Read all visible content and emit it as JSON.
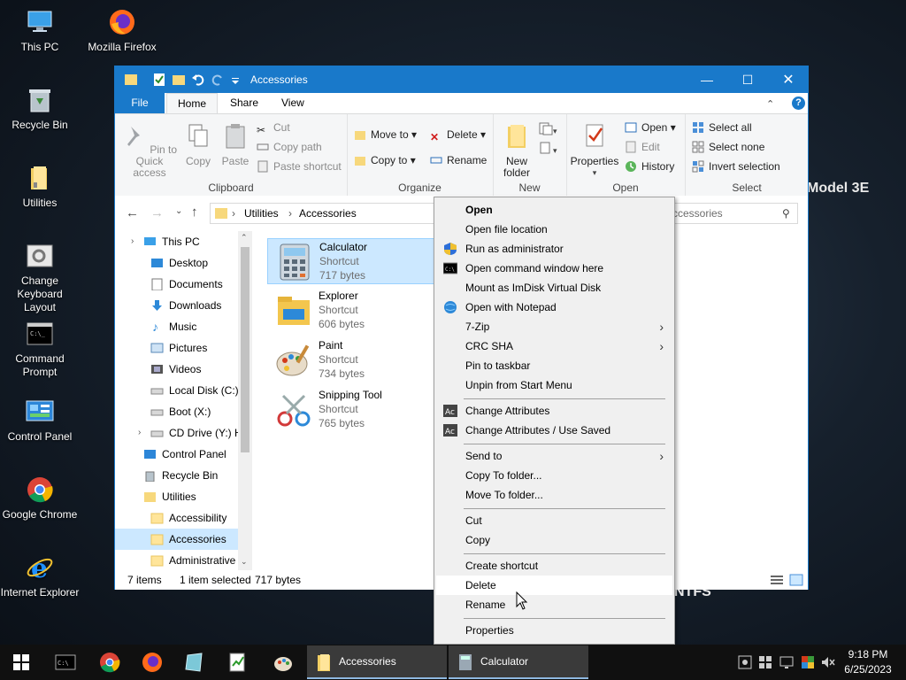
{
  "desktop": {
    "icons": [
      {
        "label": "This PC"
      },
      {
        "label": "Mozilla Firefox"
      },
      {
        "label": "Recycle Bin"
      },
      {
        "label": "Utilities"
      },
      {
        "label": "Change Keyboard Layout"
      },
      {
        "label": "Command Prompt"
      },
      {
        "label": "Control Panel"
      },
      {
        "label": "Google Chrome"
      },
      {
        "label": "Internet Explorer"
      }
    ],
    "bg_text_1": "Model 3E",
    "bg_text_2": "NTFS"
  },
  "window": {
    "title": "Accessories",
    "tabs": {
      "file": "File",
      "home": "Home",
      "share": "Share",
      "view": "View"
    },
    "ribbon": {
      "clipboard": {
        "label": "Clipboard",
        "pin": "Pin to Quick access",
        "copy": "Copy",
        "paste": "Paste",
        "cut": "Cut",
        "copy_path": "Copy path",
        "paste_shortcut": "Paste shortcut"
      },
      "organize": {
        "label": "Organize",
        "move_to": "Move to",
        "copy_to": "Copy to",
        "delete": "Delete",
        "rename": "Rename"
      },
      "new": {
        "label": "New",
        "new_folder": "New folder"
      },
      "open": {
        "label": "Open",
        "properties": "Properties",
        "open": "Open",
        "edit": "Edit",
        "history": "History"
      },
      "select": {
        "label": "Select",
        "select_all": "Select all",
        "select_none": "Select none",
        "invert": "Invert selection"
      }
    },
    "address": {
      "part1": "Utilities",
      "part2": "Accessories"
    },
    "search_placeholder": "ccessories",
    "nav": [
      {
        "label": "This PC"
      },
      {
        "label": "Desktop"
      },
      {
        "label": "Documents"
      },
      {
        "label": "Downloads"
      },
      {
        "label": "Music"
      },
      {
        "label": "Pictures"
      },
      {
        "label": "Videos"
      },
      {
        "label": "Local Disk (C:)"
      },
      {
        "label": "Boot (X:)"
      },
      {
        "label": "CD Drive (Y:) H"
      },
      {
        "label": "Control Panel"
      },
      {
        "label": "Recycle Bin"
      },
      {
        "label": "Utilities"
      },
      {
        "label": "Accessibility"
      },
      {
        "label": "Accessories"
      },
      {
        "label": "Administrative"
      }
    ],
    "files": [
      {
        "name": "Calculator",
        "type": "Shortcut",
        "size": "717 bytes"
      },
      {
        "name": "Explorer",
        "type": "Shortcut",
        "size": "606 bytes"
      },
      {
        "name": "Paint",
        "type": "Shortcut",
        "size": "734 bytes"
      },
      {
        "name": "Snipping Tool",
        "type": "Shortcut",
        "size": "765 bytes"
      }
    ],
    "status": {
      "items": "7 items",
      "selected": "1 item selected",
      "size": "717 bytes"
    }
  },
  "context_menu": [
    {
      "label": "Open"
    },
    {
      "label": "Open file location"
    },
    {
      "label": "Run as administrator"
    },
    {
      "label": "Open command window here"
    },
    {
      "label": "Mount as ImDisk Virtual Disk"
    },
    {
      "label": "Open with Notepad"
    },
    {
      "label": "7-Zip"
    },
    {
      "label": "CRC SHA"
    },
    {
      "label": "Pin to taskbar"
    },
    {
      "label": "Unpin from Start Menu"
    },
    {
      "label": "Change Attributes"
    },
    {
      "label": "Change Attributes / Use Saved"
    },
    {
      "label": "Send to"
    },
    {
      "label": "Copy To folder..."
    },
    {
      "label": "Move To folder..."
    },
    {
      "label": "Cut"
    },
    {
      "label": "Copy"
    },
    {
      "label": "Create shortcut"
    },
    {
      "label": "Delete"
    },
    {
      "label": "Rename"
    },
    {
      "label": "Properties"
    }
  ],
  "taskbar": {
    "tasks": [
      {
        "label": "Accessories"
      },
      {
        "label": "Calculator"
      }
    ],
    "time": "9:18 PM",
    "date": "6/25/2023"
  }
}
